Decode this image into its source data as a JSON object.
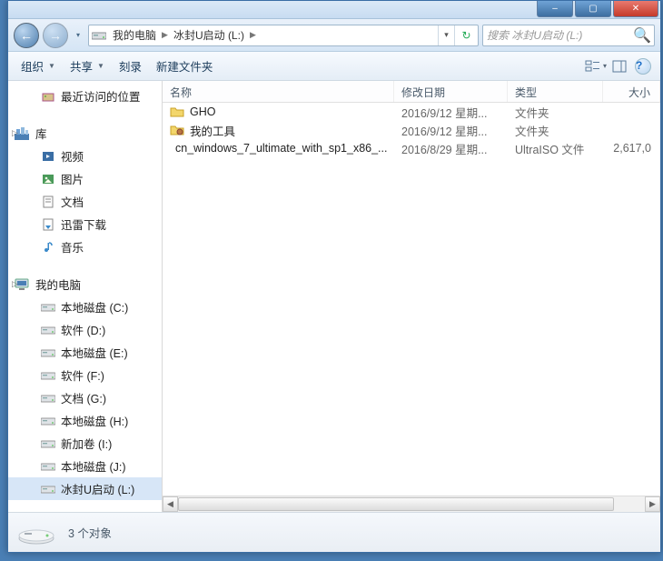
{
  "window_controls": {
    "min": "–",
    "max": "▢",
    "close": "✕"
  },
  "nav": {
    "back_glyph": "←",
    "fwd_glyph": "→",
    "hist_glyph": "▾",
    "breadcrumbs": [
      {
        "label": "我的电脑"
      },
      {
        "label": "冰封U启动 (L:)"
      }
    ],
    "refresh_glyph": "↻",
    "addr_dd_glyph": "▾"
  },
  "search": {
    "placeholder": "搜索 冰封U启动 (L:)",
    "icon_glyph": "🔍"
  },
  "toolbar": {
    "organize": "组织",
    "share": "共享",
    "burn": "刻录",
    "new_folder": "新建文件夹",
    "view_dd_glyph": "▾",
    "help_glyph": "?"
  },
  "sidebar": {
    "recent": "最近访问的位置",
    "libraries": {
      "label": "库",
      "items": [
        "视频",
        "图片",
        "文档",
        "迅雷下载",
        "音乐"
      ]
    },
    "computer": {
      "label": "我的电脑",
      "drives": [
        "本地磁盘 (C:)",
        "软件 (D:)",
        "本地磁盘 (E:)",
        "软件 (F:)",
        "文档 (G:)",
        "本地磁盘 (H:)",
        "新加卷 (I:)",
        "本地磁盘 (J:)",
        "冰封U启动 (L:)"
      ],
      "selected_index": 8
    }
  },
  "columns": {
    "name": "名称",
    "date": "修改日期",
    "type": "类型",
    "size": "大小"
  },
  "files": [
    {
      "icon": "folder",
      "name": "GHO",
      "date": "2016/9/12 星期...",
      "type": "文件夹",
      "size": ""
    },
    {
      "icon": "folder-tools",
      "name": "我的工具",
      "date": "2016/9/12 星期...",
      "type": "文件夹",
      "size": ""
    },
    {
      "icon": "disc",
      "name": "cn_windows_7_ultimate_with_sp1_x86_...",
      "date": "2016/8/29 星期...",
      "type": "UltraISO 文件",
      "size": "2,617,0"
    }
  ],
  "status": {
    "count_text": "3 个对象"
  }
}
